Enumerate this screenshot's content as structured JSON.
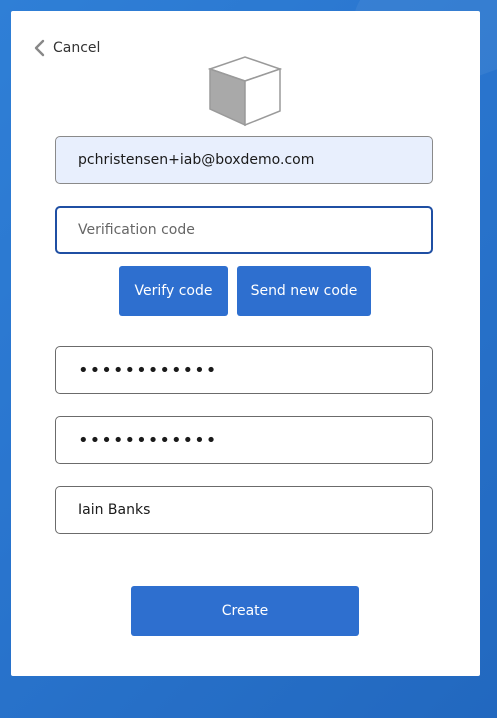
{
  "cancel": {
    "label": "Cancel",
    "icon": "chevron-left-icon"
  },
  "logo": {
    "icon": "cube-logo-icon"
  },
  "form": {
    "email_value": "pchristensen+iab@boxdemo.com",
    "verification_placeholder": "Verification code",
    "verify_label": "Verify code",
    "send_new_label": "Send new code",
    "password_value": "••••••••••••",
    "confirm_password_value": "••••••••••••",
    "name_value": "Iain Banks",
    "create_label": "Create"
  },
  "colors": {
    "accent": "#2e6fcf",
    "background": "#2a76cf",
    "email_fill": "#e8effd",
    "focus_border": "#1f4fa3"
  }
}
